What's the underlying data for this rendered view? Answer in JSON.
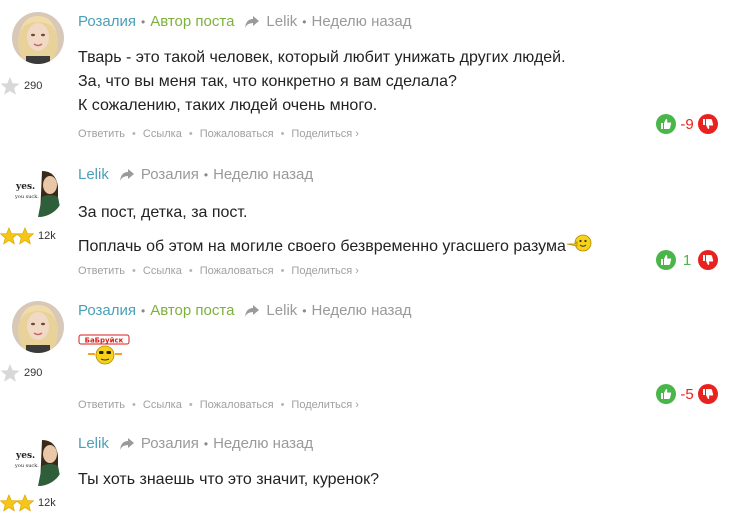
{
  "actions": {
    "reply": "Ответить",
    "link": "Ссылка",
    "report": "Пожаловаться",
    "share": "Поделиться ›"
  },
  "colors": {
    "author": "#4aa0b8",
    "op": "#7db23a",
    "muted": "#9a9a9a",
    "up": "#49b64a",
    "down": "#e8221e"
  },
  "comments": [
    {
      "author": "Розалия",
      "op_badge": "Автор поста",
      "reply_to": "Lelik",
      "time": "Неделю назад",
      "rating": "290",
      "stars": 1,
      "avatar": "girl-avatar",
      "lines": [
        "Тварь - это такой человек, который любит унижать других людей.",
        "За, что вы меня так, что конкретно я вам сделала?",
        "К сожалению, таких людей очень много."
      ],
      "score": "-9"
    },
    {
      "author": "Lelik",
      "reply_to": "Розалия",
      "time": "Неделю назад",
      "rating": "12k",
      "stars": 2,
      "avatar": "yes-you-suck-avatar",
      "avatar_text_1": "yes.",
      "avatar_text_2": "you suck.",
      "lines": [
        "За пост, детка, за пост.",
        "Поплачь об этом на могиле своего безвременно угасшего разума"
      ],
      "score": "1"
    },
    {
      "author": "Розалия",
      "op_badge": "Автор поста",
      "reply_to": "Lelik",
      "time": "Неделю назад",
      "rating": "290",
      "stars": 1,
      "avatar": "girl-avatar",
      "sticker_text": "БаБруйск",
      "score": "-5"
    },
    {
      "author": "Lelik",
      "reply_to": "Розалия",
      "time": "Неделю назад",
      "rating": "12k",
      "stars": 2,
      "avatar": "yes-you-suck-avatar",
      "avatar_text_1": "yes.",
      "avatar_text_2": "you suck.",
      "lines": [
        "Ты хоть знаешь что это значит, куренок?"
      ]
    }
  ]
}
